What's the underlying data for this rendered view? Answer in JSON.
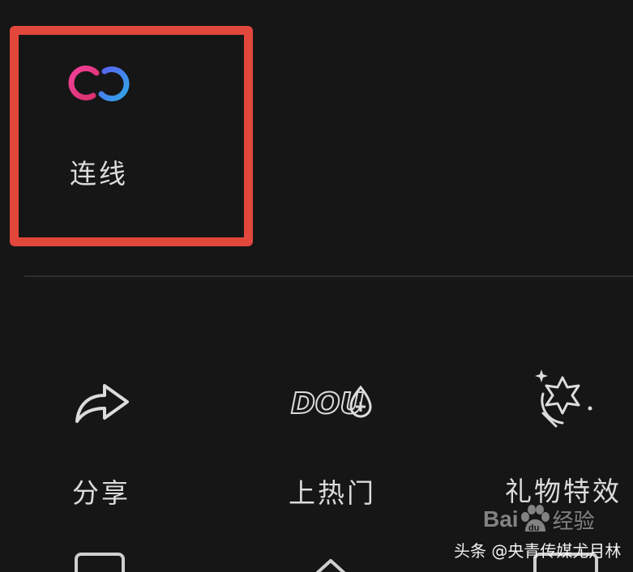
{
  "link_tile": {
    "label": "连线",
    "icon": "link-rings-icon"
  },
  "actions": [
    {
      "label": "分享",
      "icon": "share-arrow-icon"
    },
    {
      "label": "上热门",
      "icon": "dou-plus-icon",
      "icon_text": "DOU"
    },
    {
      "label": "礼物特效",
      "icon": "gift-effect-icon"
    }
  ],
  "watermarks": {
    "baidu_prefix": "Bai",
    "baidu_du": "du",
    "baidu_suffix": "经验",
    "toutiao": "头条 @央青传媒尤月林"
  },
  "colors": {
    "background": "#161616",
    "highlight": "#e2473c",
    "link_pink": "#e3347e",
    "link_blue": "#3d8fe6"
  }
}
